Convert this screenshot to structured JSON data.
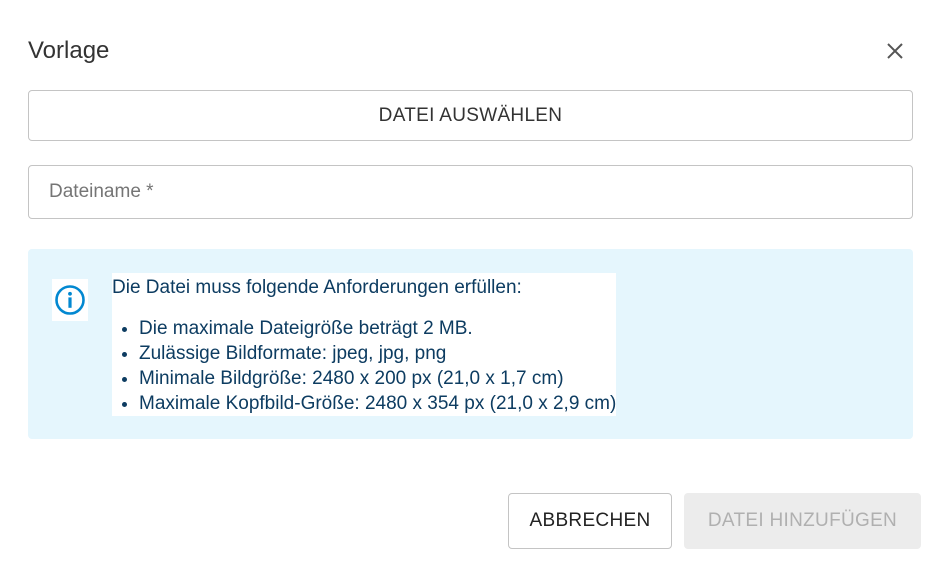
{
  "dialog": {
    "title": "Vorlage",
    "close_icon": "close-icon"
  },
  "select_file": {
    "label": "DATEI AUSWÄHLEN"
  },
  "filename": {
    "placeholder": "Dateiname *",
    "value": ""
  },
  "info": {
    "icon": "info-icon",
    "heading": "Die Datei muss folgende Anforderungen erfüllen:",
    "items": [
      "Die maximale Dateigröße beträgt 2 MB.",
      "Zulässige Bildformate: jpeg, jpg, png",
      "Minimale Bildgröße: 2480 x 200 px (21,0 x 1,7 cm)",
      "Maximale Kopfbild-Größe: 2480 x 354 px (21,0 x 2,9 cm)"
    ]
  },
  "actions": {
    "cancel_label": "ABBRECHEN",
    "add_label": "DATEI HINZUFÜGEN",
    "add_disabled": true
  },
  "colors": {
    "info_background": "#e5f6fd",
    "info_text": "#0d3c61",
    "info_icon": "#0288d1",
    "disabled_background": "#ececec",
    "disabled_text": "#b0b0b0"
  }
}
